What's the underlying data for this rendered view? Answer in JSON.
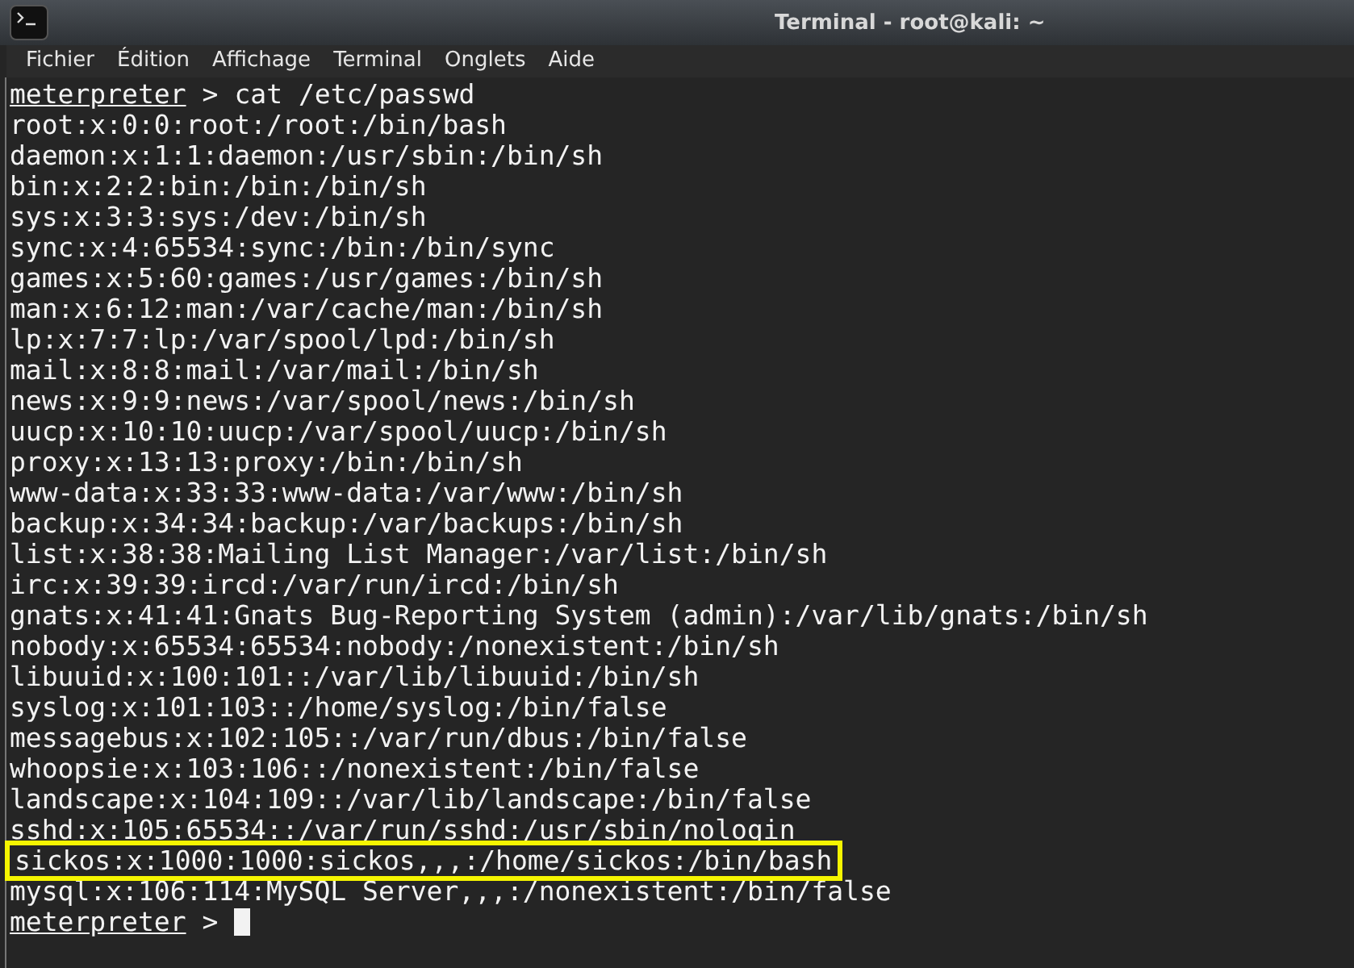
{
  "window": {
    "title": "Terminal - root@kali: ~"
  },
  "menu": [
    "Fichier",
    "Édition",
    "Affichage",
    "Terminal",
    "Onglets",
    "Aide"
  ],
  "lines": [
    {
      "kind": "prompt",
      "prompt": "meterpreter",
      "separator": ">",
      "command": "cat /etc/passwd",
      "cursor": false
    },
    {
      "kind": "output",
      "text": "root:x:0:0:root:/root:/bin/bash",
      "highlighted": false
    },
    {
      "kind": "output",
      "text": "daemon:x:1:1:daemon:/usr/sbin:/bin/sh",
      "highlighted": false
    },
    {
      "kind": "output",
      "text": "bin:x:2:2:bin:/bin:/bin/sh",
      "highlighted": false
    },
    {
      "kind": "output",
      "text": "sys:x:3:3:sys:/dev:/bin/sh",
      "highlighted": false
    },
    {
      "kind": "output",
      "text": "sync:x:4:65534:sync:/bin:/bin/sync",
      "highlighted": false
    },
    {
      "kind": "output",
      "text": "games:x:5:60:games:/usr/games:/bin/sh",
      "highlighted": false
    },
    {
      "kind": "output",
      "text": "man:x:6:12:man:/var/cache/man:/bin/sh",
      "highlighted": false
    },
    {
      "kind": "output",
      "text": "lp:x:7:7:lp:/var/spool/lpd:/bin/sh",
      "highlighted": false
    },
    {
      "kind": "output",
      "text": "mail:x:8:8:mail:/var/mail:/bin/sh",
      "highlighted": false
    },
    {
      "kind": "output",
      "text": "news:x:9:9:news:/var/spool/news:/bin/sh",
      "highlighted": false
    },
    {
      "kind": "output",
      "text": "uucp:x:10:10:uucp:/var/spool/uucp:/bin/sh",
      "highlighted": false
    },
    {
      "kind": "output",
      "text": "proxy:x:13:13:proxy:/bin:/bin/sh",
      "highlighted": false
    },
    {
      "kind": "output",
      "text": "www-data:x:33:33:www-data:/var/www:/bin/sh",
      "highlighted": false
    },
    {
      "kind": "output",
      "text": "backup:x:34:34:backup:/var/backups:/bin/sh",
      "highlighted": false
    },
    {
      "kind": "output",
      "text": "list:x:38:38:Mailing List Manager:/var/list:/bin/sh",
      "highlighted": false
    },
    {
      "kind": "output",
      "text": "irc:x:39:39:ircd:/var/run/ircd:/bin/sh",
      "highlighted": false
    },
    {
      "kind": "output",
      "text": "gnats:x:41:41:Gnats Bug-Reporting System (admin):/var/lib/gnats:/bin/sh",
      "highlighted": false
    },
    {
      "kind": "output",
      "text": "nobody:x:65534:65534:nobody:/nonexistent:/bin/sh",
      "highlighted": false
    },
    {
      "kind": "output",
      "text": "libuuid:x:100:101::/var/lib/libuuid:/bin/sh",
      "highlighted": false
    },
    {
      "kind": "output",
      "text": "syslog:x:101:103::/home/syslog:/bin/false",
      "highlighted": false
    },
    {
      "kind": "output",
      "text": "messagebus:x:102:105::/var/run/dbus:/bin/false",
      "highlighted": false
    },
    {
      "kind": "output",
      "text": "whoopsie:x:103:106::/nonexistent:/bin/false",
      "highlighted": false
    },
    {
      "kind": "output",
      "text": "landscape:x:104:109::/var/lib/landscape:/bin/false",
      "highlighted": false
    },
    {
      "kind": "output",
      "text": "sshd:x:105:65534::/var/run/sshd:/usr/sbin/nologin",
      "highlighted": false
    },
    {
      "kind": "output",
      "text": "sickos:x:1000:1000:sickos,,,:/home/sickos:/bin/bash",
      "highlighted": true
    },
    {
      "kind": "output",
      "text": "mysql:x:106:114:MySQL Server,,,:/nonexistent:/bin/false",
      "highlighted": false
    },
    {
      "kind": "prompt",
      "prompt": "meterpreter",
      "separator": ">",
      "cursor": true
    }
  ]
}
